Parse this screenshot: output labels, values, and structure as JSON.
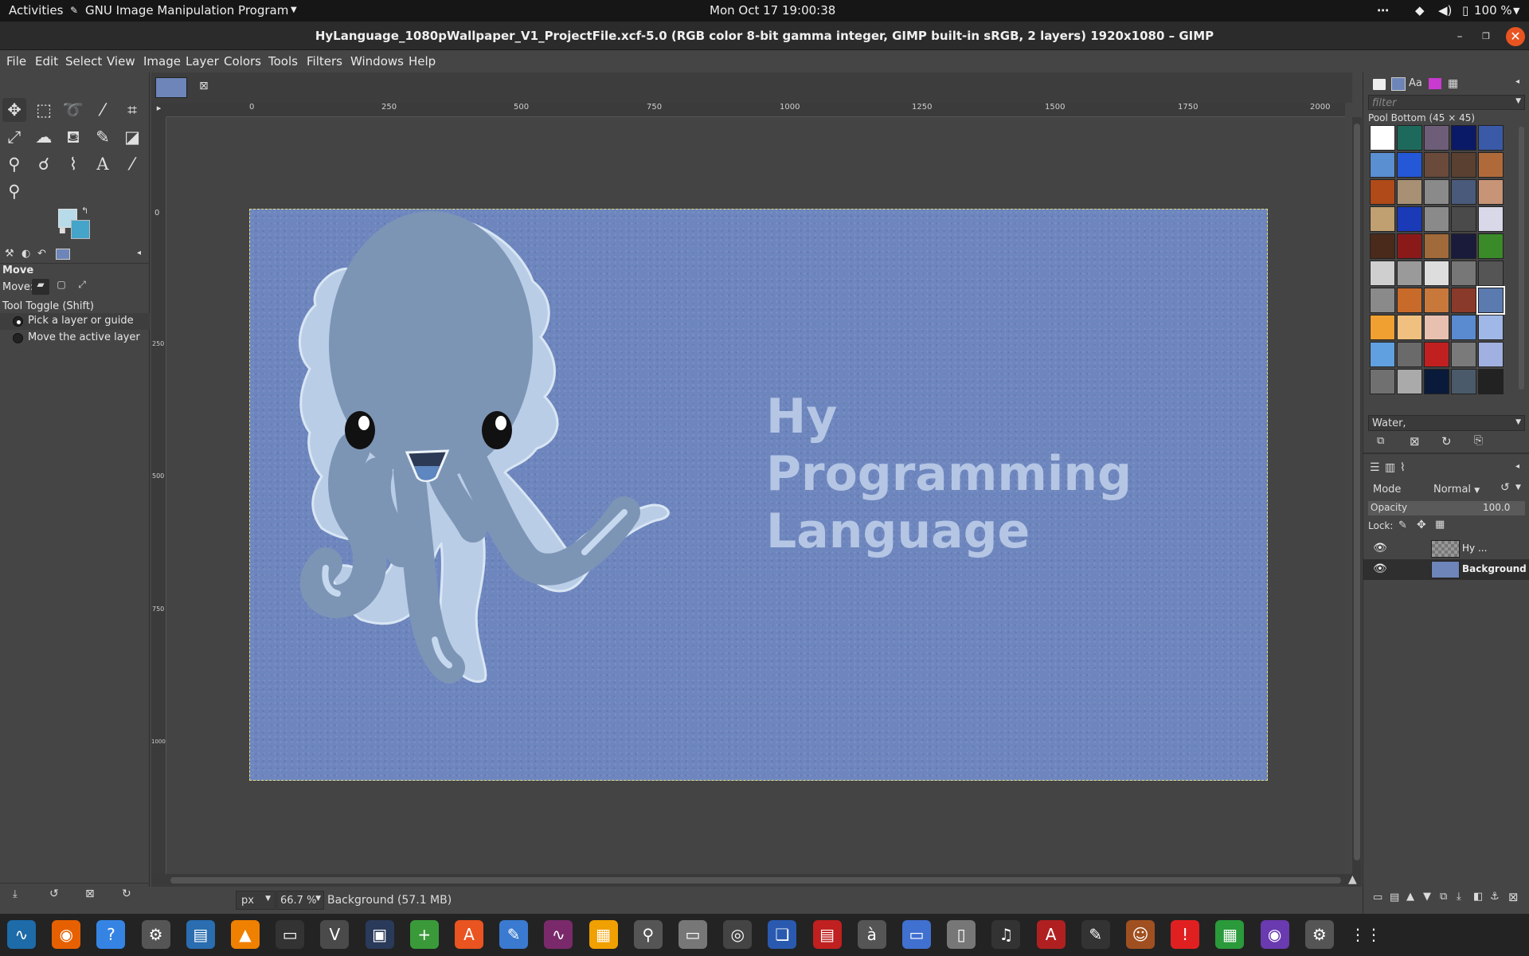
{
  "topbar": {
    "activities": "Activities",
    "app_menu": "GNU Image Manipulation Program",
    "datetime": "Mon Oct 17  19:00:38",
    "battery": "100 %"
  },
  "window": {
    "title": "HyLanguage_1080pWallpaper_V1_ProjectFile.xcf-5.0 (RGB color 8-bit gamma integer, GIMP built-in sRGB, 2 layers) 1920x1080 – GIMP"
  },
  "menu": [
    "File",
    "Edit",
    "Select",
    "View",
    "Image",
    "Layer",
    "Colors",
    "Tools",
    "Filters",
    "Windows",
    "Help"
  ],
  "tool_options": {
    "title": "Move",
    "move_label": "Move:",
    "toggle_label": "Tool Toggle  (Shift)",
    "option1": "Pick a layer or guide",
    "option2": "Move the active layer"
  },
  "rulers": {
    "h": [
      "0",
      "250",
      "500",
      "750",
      "1000",
      "1250",
      "1500",
      "1750",
      "2000"
    ],
    "v": [
      "0",
      "250",
      "500",
      "750",
      "1000"
    ]
  },
  "canvas": {
    "text_layer": "Hy\nProgramming\nLanguage"
  },
  "statusbar": {
    "unit": "px",
    "zoom": "66.7 %",
    "info": "Background (57.1 MB)"
  },
  "patterns": {
    "filter_placeholder": "filter",
    "selected_name": "Pool Bottom (45 × 45)",
    "tag_text": "Water,",
    "colors": [
      "#ffffff",
      "#1d6a5c",
      "#6e5d78",
      "#0b1a66",
      "#3a5aa8",
      "#5a8fd1",
      "#2458d6",
      "#6a4a3a",
      "#5a4030",
      "#b06a3a",
      "#b04a18",
      "#a89074",
      "#8a8a8a",
      "#4a5a7a",
      "#c89478",
      "#c0a070",
      "#1a3ab8",
      "#8a8a8a",
      "#4a4a4a",
      "#d8d8e8",
      "#4a2a1a",
      "#8a1a1a",
      "#a06a3a",
      "#1a1a3a",
      "#3a8a2a",
      "#cfcfcf",
      "#9a9a9a",
      "#dddddd",
      "#777777",
      "#555555",
      "#8a8a8a",
      "#c86a2a",
      "#c8783a",
      "#8a3a2a",
      "#5a7ab0",
      "#f0a030",
      "#f0c080",
      "#e8c0b0",
      "#5a8ad0",
      "#a0b8e8",
      "#60a0e0",
      "#6a6a6a",
      "#c02020",
      "#7a7a7a",
      "#a0b0e0",
      "#707070",
      "#aaaaaa",
      "#0a1a3a",
      "#4a5a6a",
      "#222222"
    ],
    "selected_index": 34
  },
  "layers": {
    "mode_label": "Mode",
    "mode_value": "Normal",
    "opacity_label": "Opacity",
    "opacity_value": "100.0",
    "lock_label": "Lock:",
    "items": [
      {
        "name": "Hy ..."
      },
      {
        "name": "Background"
      }
    ]
  },
  "dock_icons": [
    "system-monitor-icon",
    "firefox-icon",
    "help-icon",
    "settings-icon",
    "writer-icon",
    "vlc-icon",
    "terminal-icon",
    "vim-icon",
    "remote-desktop-icon",
    "add-icon",
    "software-icon",
    "text-editor-icon",
    "graph-icon",
    "calculator-icon",
    "image-viewer-icon",
    "files-icon",
    "dashboard-icon",
    "bookmark-icon",
    "slides-icon",
    "character-map-icon",
    "screen-icon",
    "archive-icon",
    "music-icon",
    "pdf-icon",
    "gimp-icon",
    "game-icon",
    "alert-icon",
    "spreadsheet-icon",
    "screenshot-icon",
    "updater-icon",
    "app-grid-icon"
  ]
}
